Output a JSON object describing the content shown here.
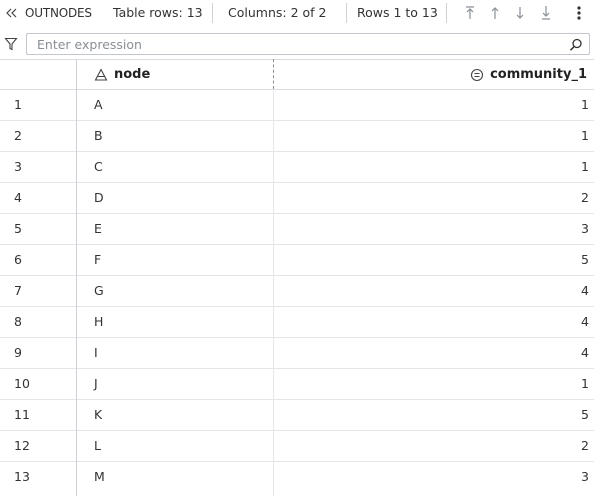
{
  "toolbar": {
    "dataset_name": "OUTNODES",
    "table_rows": "Table rows: 13",
    "columns": "Columns: 2 of 2",
    "rows_range": "Rows 1 to 13"
  },
  "filter": {
    "placeholder": "Enter expression",
    "value": ""
  },
  "columns": [
    {
      "label": "node",
      "icon": "character-type-icon"
    },
    {
      "label": "community_1",
      "icon": "numeric-type-icon"
    }
  ],
  "rows": [
    {
      "n": "1",
      "node": "A",
      "community": "1"
    },
    {
      "n": "2",
      "node": "B",
      "community": "1"
    },
    {
      "n": "3",
      "node": "C",
      "community": "1"
    },
    {
      "n": "4",
      "node": "D",
      "community": "2"
    },
    {
      "n": "5",
      "node": "E",
      "community": "3"
    },
    {
      "n": "6",
      "node": "F",
      "community": "5"
    },
    {
      "n": "7",
      "node": "G",
      "community": "4"
    },
    {
      "n": "8",
      "node": "H",
      "community": "4"
    },
    {
      "n": "9",
      "node": "I",
      "community": "4"
    },
    {
      "n": "10",
      "node": "J",
      "community": "1"
    },
    {
      "n": "11",
      "node": "K",
      "community": "5"
    },
    {
      "n": "12",
      "node": "L",
      "community": "2"
    },
    {
      "n": "13",
      "node": "M",
      "community": "3"
    }
  ]
}
